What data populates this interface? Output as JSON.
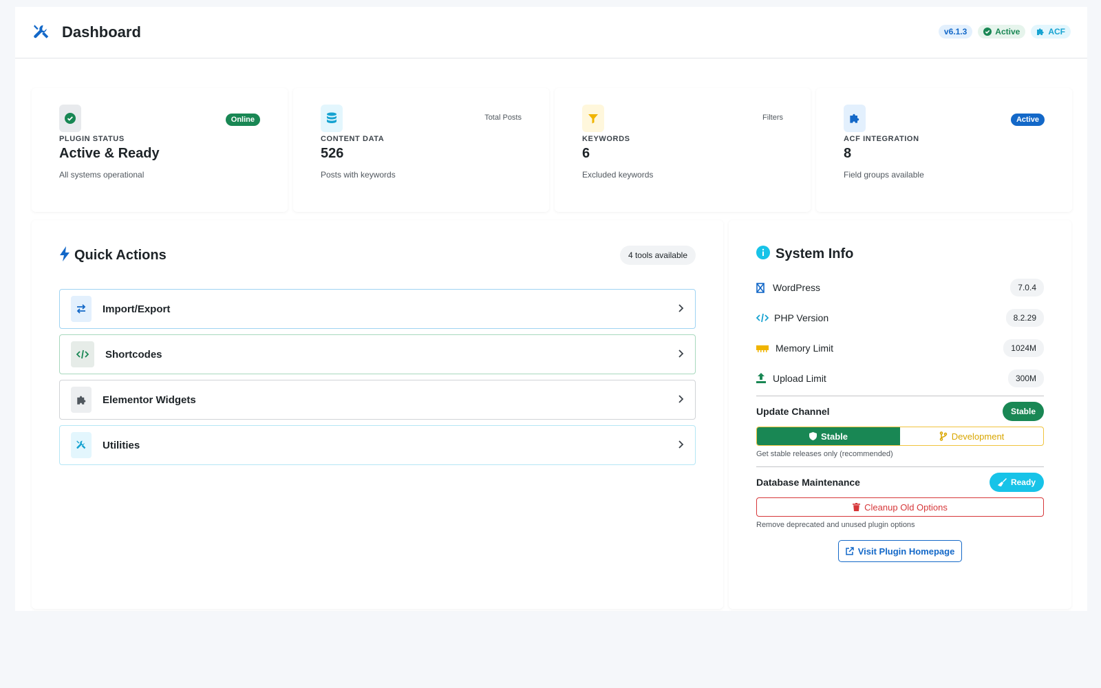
{
  "header": {
    "title": "Dashboard",
    "version": "v6.1.3",
    "status": "Active",
    "integration": "ACF"
  },
  "stats": [
    {
      "tag": "Online",
      "label": "PLUGIN STATUS",
      "value": "Active & Ready",
      "sub": "All systems operational",
      "icon": "check-circle-icon",
      "color": "#198754"
    },
    {
      "tag": "Total Posts",
      "label": "CONTENT DATA",
      "value": "526",
      "sub": "Posts with keywords",
      "icon": "database-icon",
      "color": "#17a3d1"
    },
    {
      "tag": "Filters",
      "label": "KEYWORDS",
      "value": "6",
      "sub": "Excluded keywords",
      "icon": "filter-icon",
      "color": "#f0b400"
    },
    {
      "tag": "Active",
      "label": "ACF INTEGRATION",
      "value": "8",
      "sub": "Field groups available",
      "icon": "puzzle-icon",
      "color": "#1368c8"
    }
  ],
  "quick_actions": {
    "title": "Quick Actions",
    "count": "4 tools available",
    "items": [
      {
        "label": "Import/Export",
        "icon": "arrows-exchange-icon"
      },
      {
        "label": "Shortcodes",
        "icon": "code-icon"
      },
      {
        "label": "Elementor Widgets",
        "icon": "puzzle-icon"
      },
      {
        "label": "Utilities",
        "icon": "tools-icon"
      }
    ]
  },
  "system_info": {
    "title": "System Info",
    "rows": [
      {
        "name": "WordPress",
        "value": "7.0.4",
        "icon": "wordpress-icon"
      },
      {
        "name": "PHP Version",
        "value": "8.2.29",
        "icon": "code-icon"
      },
      {
        "name": "Memory Limit",
        "value": "1024M",
        "icon": "memory-icon"
      },
      {
        "name": "Upload Limit",
        "value": "300M",
        "icon": "upload-icon"
      }
    ],
    "update_channel": {
      "title": "Update Channel",
      "badge": "Stable",
      "options": [
        "Stable",
        "Development"
      ],
      "hint": "Get stable releases only (recommended)"
    },
    "db_maintenance": {
      "title": "Database Maintenance",
      "badge": "Ready",
      "button": "Cleanup Old Options",
      "hint": "Remove deprecated and unused plugin options"
    },
    "visit_button": "Visit Plugin Homepage"
  },
  "colors": {
    "primary": "#1368c8",
    "success": "#198754",
    "info": "#17a3d1",
    "warning": "#f0b400",
    "danger": "#d63638"
  }
}
